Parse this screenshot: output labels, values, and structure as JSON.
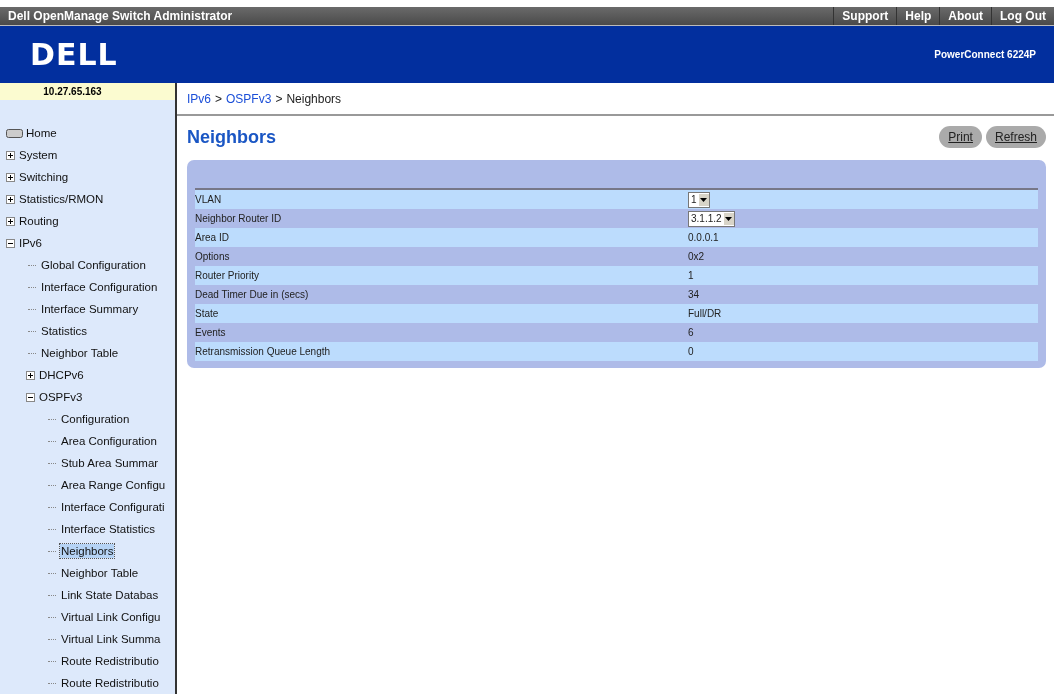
{
  "top_bar": {
    "title": "Dell OpenManage Switch Administrator",
    "links": [
      "Support",
      "Help",
      "About",
      "Log Out"
    ]
  },
  "header": {
    "logo": "DELL",
    "model": "PowerConnect 6224P"
  },
  "ip_address": "10.27.65.163",
  "breadcrumb": {
    "items": [
      {
        "label": "IPv6",
        "kind": "link"
      },
      {
        "label": ">",
        "kind": "separator"
      },
      {
        "label": "OSPFv3",
        "kind": "link"
      },
      {
        "label": ">",
        "kind": "separator"
      },
      {
        "label": "Neighbors",
        "kind": "current"
      }
    ]
  },
  "sidebar": {
    "items": [
      {
        "label": "Home",
        "kind": "root",
        "selected": false
      },
      {
        "label": "System",
        "kind": "folder",
        "expanded": false,
        "selected": false
      },
      {
        "label": "Switching",
        "kind": "folder",
        "expanded": false,
        "selected": false
      },
      {
        "label": "Statistics/RMON",
        "kind": "folder",
        "expanded": false,
        "selected": false
      },
      {
        "label": "Routing",
        "kind": "folder",
        "expanded": false,
        "selected": false
      },
      {
        "label": "IPv6",
        "kind": "folder",
        "expanded": true,
        "selected": false,
        "children": [
          {
            "label": "Global Configuration",
            "kind": "page",
            "selected": false
          },
          {
            "label": "Interface Configuration",
            "kind": "page",
            "selected": false
          },
          {
            "label": "Interface Summary",
            "kind": "page",
            "selected": false
          },
          {
            "label": "Statistics",
            "kind": "page",
            "selected": false
          },
          {
            "label": "Neighbor Table",
            "kind": "page",
            "selected": false
          },
          {
            "label": "DHCPv6",
            "kind": "folder",
            "expanded": false,
            "selected": false
          },
          {
            "label": "OSPFv3",
            "kind": "folder",
            "expanded": true,
            "selected": false,
            "children": [
              {
                "label": "Configuration",
                "kind": "page",
                "selected": false
              },
              {
                "label": "Area Configuration",
                "kind": "page",
                "selected": false
              },
              {
                "label": "Stub Area Summar",
                "kind": "page",
                "selected": false
              },
              {
                "label": "Area Range Configu",
                "kind": "page",
                "selected": false
              },
              {
                "label": "Interface Configurati",
                "kind": "page",
                "selected": false
              },
              {
                "label": "Interface Statistics",
                "kind": "page",
                "selected": false
              },
              {
                "label": "Neighbors",
                "kind": "page",
                "selected": true
              },
              {
                "label": "Neighbor Table",
                "kind": "page",
                "selected": false
              },
              {
                "label": "Link State Databas",
                "kind": "page",
                "selected": false
              },
              {
                "label": "Virtual Link Configu",
                "kind": "page",
                "selected": false
              },
              {
                "label": "Virtual Link Summa",
                "kind": "page",
                "selected": false
              },
              {
                "label": "Route Redistributio",
                "kind": "page",
                "selected": false
              },
              {
                "label": "Route Redistributio",
                "kind": "page",
                "selected": false
              }
            ]
          }
        ]
      }
    ]
  },
  "page": {
    "title": "Neighbors",
    "buttons": [
      "Print",
      "Refresh"
    ]
  },
  "form": {
    "rows": [
      {
        "label": "VLAN",
        "kind": "select",
        "value": "1"
      },
      {
        "label": "Neighbor Router ID",
        "kind": "select",
        "value": "3.1.1.2"
      },
      {
        "label": "Area ID",
        "kind": "text",
        "value": "0.0.0.1"
      },
      {
        "label": "Options",
        "kind": "text",
        "value": "0x2"
      },
      {
        "label": "Router Priority",
        "kind": "text",
        "value": "1"
      },
      {
        "label": "Dead Timer Due in (secs)",
        "kind": "text",
        "value": "34"
      },
      {
        "label": "State",
        "kind": "text",
        "value": "Full/DR"
      },
      {
        "label": "Events",
        "kind": "text",
        "value": "6"
      },
      {
        "label": "Retransmission Queue Length",
        "kind": "text",
        "value": "0"
      }
    ]
  }
}
